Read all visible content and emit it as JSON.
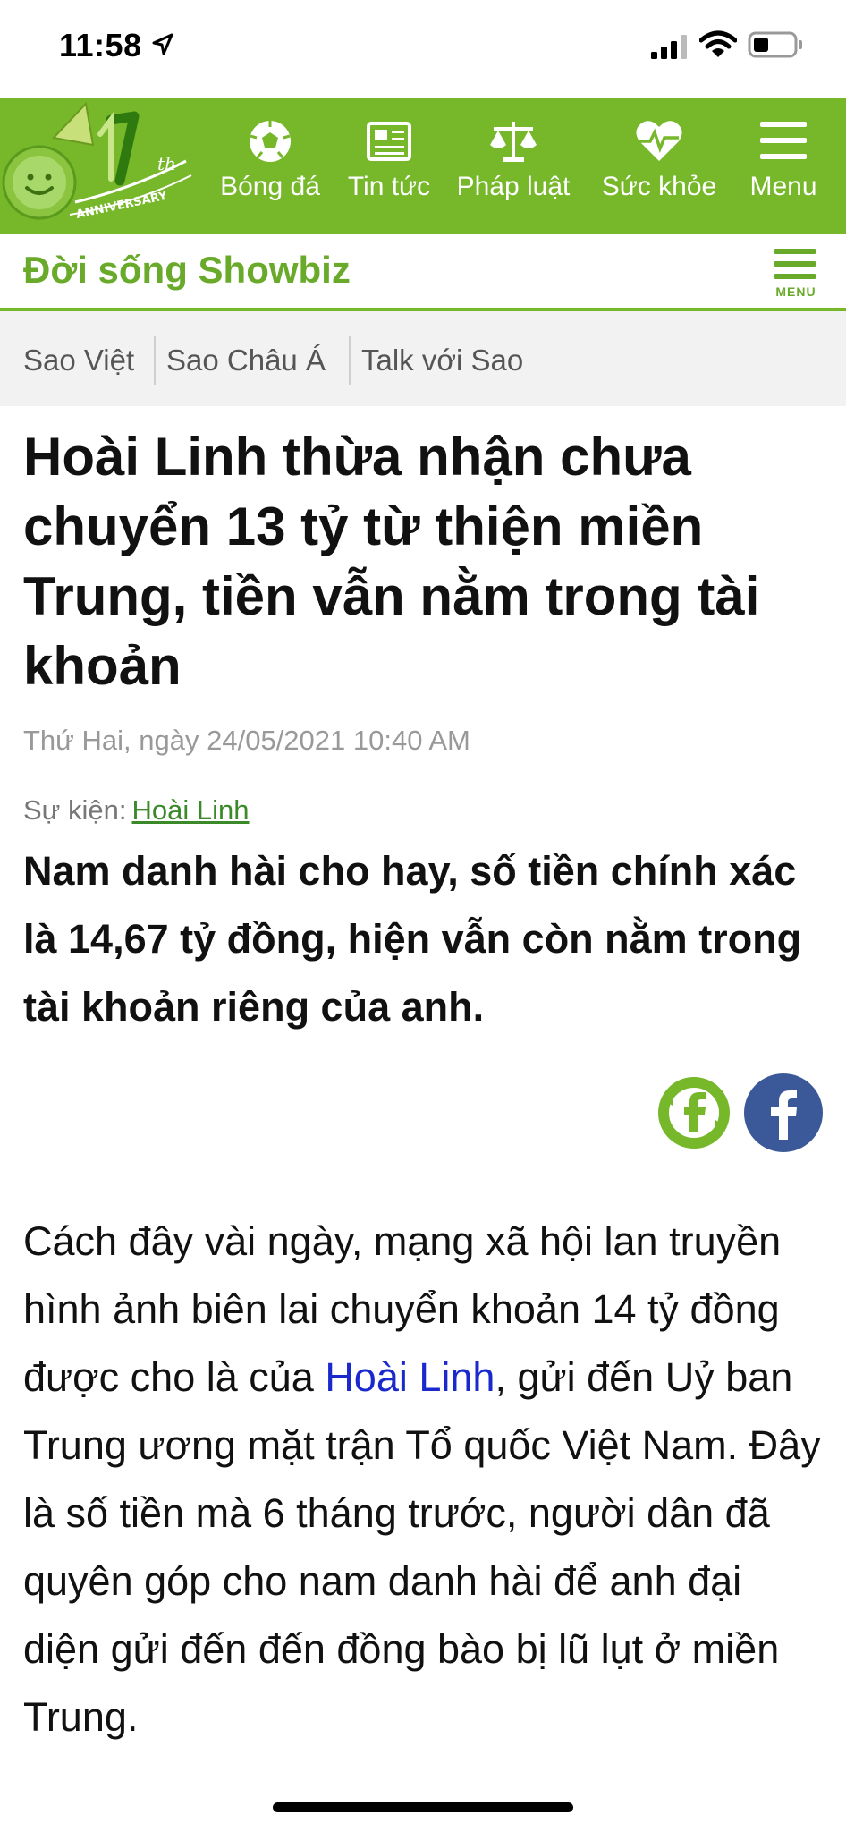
{
  "status_bar": {
    "time": "11:58"
  },
  "nav": {
    "items": [
      {
        "label": "Bóng đá",
        "icon": "soccer-ball-icon"
      },
      {
        "label": "Tin tức",
        "icon": "newspaper-icon"
      },
      {
        "label": "Pháp luật",
        "icon": "scales-icon"
      },
      {
        "label": "Sức khỏe",
        "icon": "heart-pulse-icon"
      },
      {
        "label": "Menu",
        "icon": "hamburger-icon"
      }
    ],
    "brand_color": "#76b82a"
  },
  "section": {
    "title": "Đời sống Showbiz",
    "menu_label": "MENU"
  },
  "sub_tabs": [
    "Sao Việt",
    "Sao Châu Á",
    "Talk với Sao"
  ],
  "article": {
    "title": "Hoài Linh thừa nhận chưa chuyển 13 tỷ từ thiện miền Trung, tiền vẫn nằm trong tài khoản",
    "date": "Thứ Hai, ngày 24/05/2021 10:40 AM",
    "event_label": "Sự kiện:",
    "event_link": "Hoài Linh",
    "sapo": "Nam danh hài cho hay, số tiền chính xác là 14,67 tỷ đồng, hiện vẫn còn nằm trong tài khoản riêng của anh.",
    "body_part1": "Cách đây vài ngày, mạng xã hội lan truyền hình ảnh biên lai chuyển khoản 14 tỷ đồng được cho là của ",
    "body_link": "Hoài Linh",
    "body_part2": ", gửi đến Uỷ ban Trung ương mặt trận Tổ quốc Việt Nam. Đây là số tiền mà 6 tháng trước, người dân đã quyên góp cho nam danh hài để anh đại diện gửi đến đến đồng bào bị lũ lụt ở miền Trung."
  }
}
